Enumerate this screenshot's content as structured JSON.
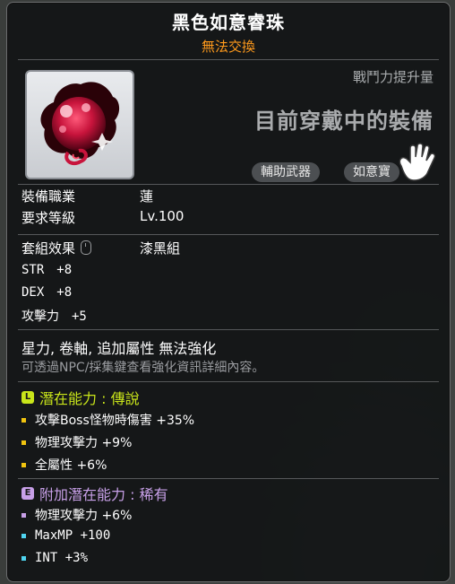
{
  "item": {
    "name": "黑色如意睿珠",
    "trade": "無法交換",
    "combat_power_label": "戰鬥力提升量",
    "equipped_label": "目前穿戴中的裝備",
    "chips": [
      "輔助武器",
      "如意寶"
    ]
  },
  "requirements": {
    "job_label": "裝備職業",
    "job_value": "蓮",
    "level_label": "要求等級",
    "level_value": "Lv.100"
  },
  "set": {
    "label": "套組效果",
    "value": "漆黑組"
  },
  "stats": [
    {
      "name": "STR",
      "value": "+8"
    },
    {
      "name": "DEX",
      "value": "+8"
    },
    {
      "name": "攻擊力",
      "value": "+5"
    }
  ],
  "notes": {
    "misc": "星力, 卷軸, 追加屬性 無法強化",
    "hint": "可透過NPC/採集鍵查看強化資訊詳細內容。"
  },
  "potential": {
    "badge": "L",
    "header": "潛在能力 : 傳說",
    "color": "#c9e51a",
    "bullet_color": "#f1c40f",
    "lines": [
      "攻擊Boss怪物時傷害 +35%",
      "物理攻擊力 +9%",
      "全屬性 +6%"
    ]
  },
  "bonus_potential": {
    "badge": "E",
    "header": "附加潛在能力 : 稀有",
    "color": "#c8a0e8",
    "lines": [
      {
        "text": "物理攻擊力 +6%",
        "bullet_color": "#c8a0e8"
      },
      {
        "text": "MaxMP +100",
        "bullet_color": "#4fd4f0"
      },
      {
        "text": "INT +3%",
        "bullet_color": "#4fd4f0"
      }
    ]
  },
  "icons": {
    "item": "dark-red-orb-icon",
    "hand": "pointer-hand-icon",
    "mouse": "mouse-icon"
  }
}
